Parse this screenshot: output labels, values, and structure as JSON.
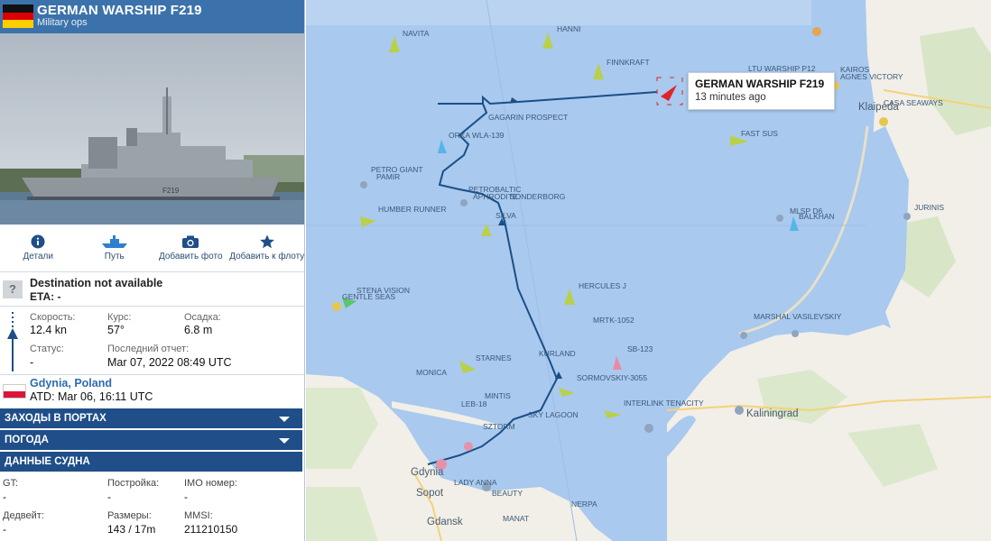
{
  "header": {
    "title": "GERMAN WARSHIP F219",
    "subtitle": "Military ops",
    "flag_colors": [
      "#111111",
      "#dd0000",
      "#ffce00"
    ]
  },
  "actions": [
    {
      "label": "Детали",
      "icon": "info-icon"
    },
    {
      "label": "Путь",
      "icon": "ship-route-icon"
    },
    {
      "label": "Добавить фото",
      "icon": "camera-icon"
    },
    {
      "label": "Добавить к флоту",
      "icon": "star-icon"
    }
  ],
  "destination": {
    "icon_text": "?",
    "text": "Destination not available",
    "eta": "ETA: -"
  },
  "stats": {
    "speed_label": "Скорость:",
    "speed": "12.4 kn",
    "course_label": "Курс:",
    "course": "57°",
    "draught_label": "Осадка:",
    "draught": "6.8 m",
    "status_label": "Статус:",
    "status": "-",
    "last_report_label": "Последний отчет:",
    "last_report": "Mar 07, 2022 08:49 UTC"
  },
  "departure": {
    "port": "Gdynia, Poland",
    "atd": "ATD: Mar 06, 16:11 UTC"
  },
  "sections": {
    "port_calls": "ЗАХОДЫ В ПОРТАХ",
    "weather": "ПОГОДА",
    "vessel_data": "ДАННЫЕ СУДНА"
  },
  "vessel": {
    "gt_label": "GT:",
    "gt": "-",
    "built_label": "Постройка:",
    "built": "-",
    "imo_label": "IMO номер:",
    "imo": "-",
    "dwt_label": "Дедвейт:",
    "dwt": "-",
    "size_label": "Размеры:",
    "size": "143 / 17m",
    "mmsi_label": "MMSI:",
    "mmsi": "211210150"
  },
  "tooltip": {
    "name": "GERMAN WARSHIP F219",
    "time": "13 minutes ago"
  },
  "map": {
    "cities": [
      "Klaipėda",
      "Kaliningrad",
      "Gdynia",
      "Sopot",
      "Gdansk"
    ],
    "vessels": [
      "NAVITA",
      "HANNI",
      "FINNKRAFT",
      "LTU WARSHIP P12",
      "KAIROS",
      "AGNES VICTORY",
      "CASA SEAWAYS",
      "GAGARIN PROSPECT",
      "ORKA WLA-139",
      "FAST SUS",
      "PETRO GIANT",
      "PAMIR",
      "PETROBALTIC",
      "APHRODITE",
      "SONDERBORG",
      "SILVA",
      "HUMBER RUNNER",
      "MLSP D6",
      "BALKHAN",
      "JURINIS",
      "STENA VISION",
      "GENTLE SEAS",
      "HERCULES J",
      "MRTK-1052",
      "MARSHAL VASILEVSKIY",
      "STARNES",
      "KURLAND",
      "SB-123",
      "MONICA",
      "SORMOVSKIY-3055",
      "MINTIS",
      "LEB-18",
      "INTERLINK TENACITY",
      "SZTORM",
      "SKY LAGOON",
      "NERPA",
      "MANAT",
      "LADY ANNA",
      "BEAUTY"
    ],
    "colors": {
      "sea": "#a9c9ee",
      "land": "#f1efe8",
      "track": "#1a4f87",
      "target": "#e0232b"
    }
  }
}
